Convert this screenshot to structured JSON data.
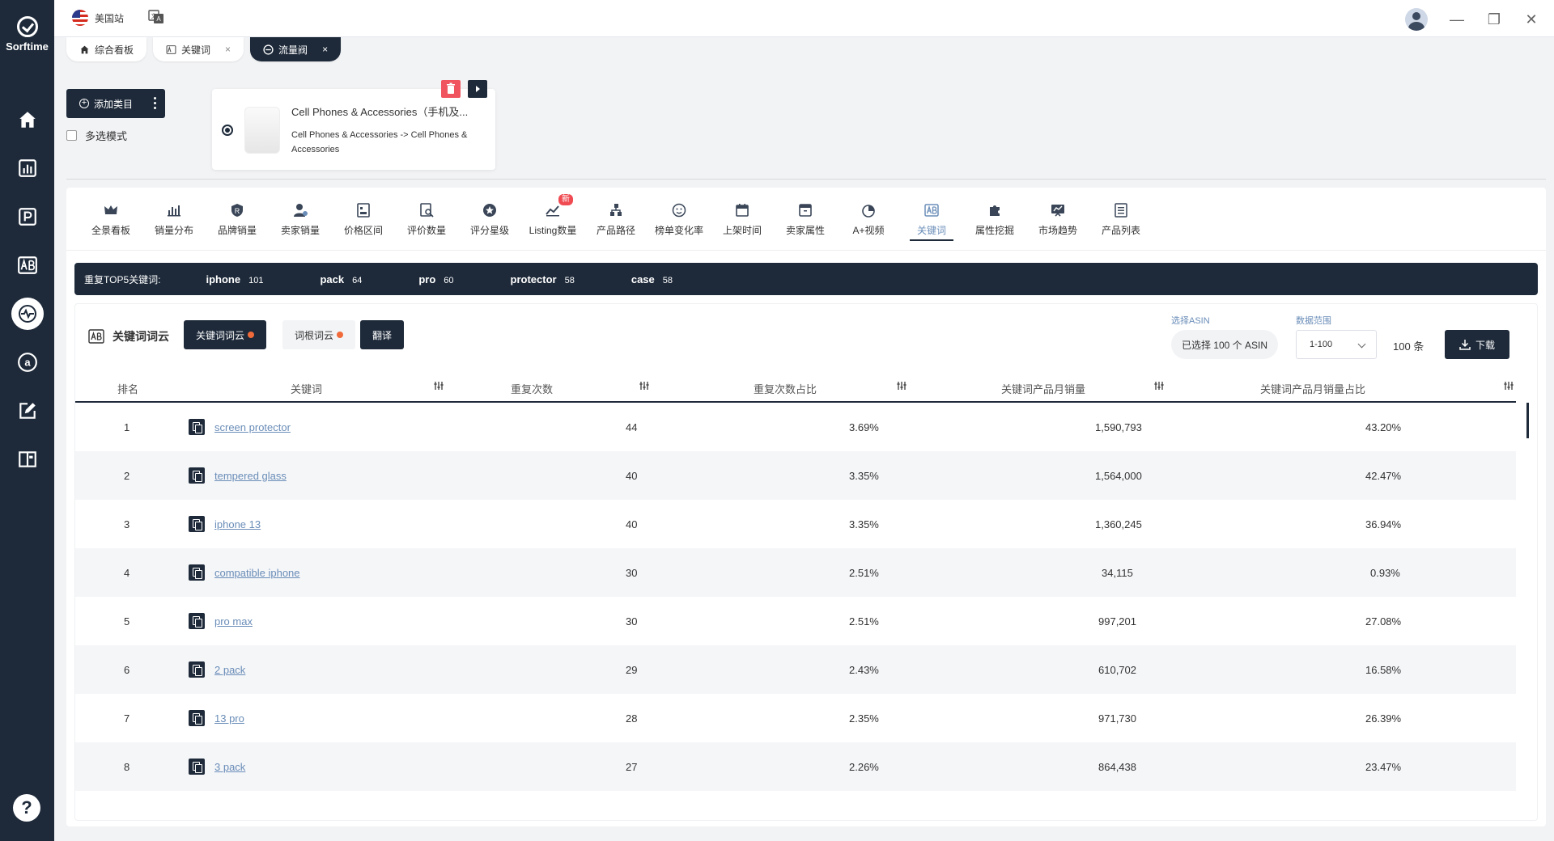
{
  "brand": {
    "name": "Sorftime"
  },
  "sidebar": {
    "items": [
      {
        "icon": "home-icon"
      },
      {
        "icon": "chart-icon"
      },
      {
        "icon": "product-icon"
      },
      {
        "icon": "keyword-icon"
      },
      {
        "icon": "traffic-icon"
      },
      {
        "icon": "amazon-icon"
      },
      {
        "icon": "edit-icon"
      },
      {
        "icon": "book-icon"
      }
    ],
    "help_label": "?"
  },
  "topbar": {
    "site": "美国站"
  },
  "tabs": [
    {
      "label": "综合看板",
      "closable": false,
      "active": false
    },
    {
      "label": "关键词",
      "closable": true,
      "active": false
    },
    {
      "label": "流量阀",
      "closable": true,
      "active": true
    }
  ],
  "category": {
    "add_label": "添加类目",
    "multi_label": "多选模式",
    "card_title": "Cell Phones & Accessories（手机及...",
    "card_path": "Cell Phones & Accessories -> Cell Phones & Accessories"
  },
  "functions": [
    {
      "label": "全景看板"
    },
    {
      "label": "销量分布"
    },
    {
      "label": "品牌销量"
    },
    {
      "label": "卖家销量"
    },
    {
      "label": "价格区间"
    },
    {
      "label": "评价数量"
    },
    {
      "label": "评分星级"
    },
    {
      "label": "Listing数量",
      "badge": "新"
    },
    {
      "label": "产品路径"
    },
    {
      "label": "榜单变化率"
    },
    {
      "label": "上架时间"
    },
    {
      "label": "卖家属性"
    },
    {
      "label": "A+视频"
    },
    {
      "label": "关键词",
      "active": true
    },
    {
      "label": "属性挖掘"
    },
    {
      "label": "市场趋势"
    },
    {
      "label": "产品列表"
    }
  ],
  "top5": {
    "label": "重复TOP5关键词:",
    "keywords": [
      {
        "word": "iphone",
        "count": "101"
      },
      {
        "word": "pack",
        "count": "64"
      },
      {
        "word": "pro",
        "count": "60"
      },
      {
        "word": "protector",
        "count": "58"
      },
      {
        "word": "case",
        "count": "58"
      }
    ]
  },
  "cloud": {
    "title": "关键词词云",
    "btn_keyword_cloud": "关键词词云",
    "btn_root_cloud": "词根词云",
    "btn_translate": "翻译",
    "asin_label": "选择ASIN",
    "asin_value": "已选择 100 个 ASIN",
    "range_label": "数据范围",
    "range_value": "1-100",
    "count": "100 条",
    "download": "下载"
  },
  "table": {
    "headers": [
      "排名",
      "关键词",
      "重复次数",
      "重复次数占比",
      "关键词产品月销量",
      "关键词产品月销量占比"
    ],
    "rows": [
      {
        "rank": "1",
        "keyword": "screen protector",
        "repeat": "44",
        "ratio": "3.69%",
        "sales": "1,590,793",
        "sales_ratio": "43.20%"
      },
      {
        "rank": "2",
        "keyword": "tempered glass",
        "repeat": "40",
        "ratio": "3.35%",
        "sales": "1,564,000",
        "sales_ratio": "42.47%"
      },
      {
        "rank": "3",
        "keyword": "iphone 13",
        "repeat": "40",
        "ratio": "3.35%",
        "sales": "1,360,245",
        "sales_ratio": "36.94%"
      },
      {
        "rank": "4",
        "keyword": "compatible iphone",
        "repeat": "30",
        "ratio": "2.51%",
        "sales": "34,115",
        "sales_ratio": "0.93%"
      },
      {
        "rank": "5",
        "keyword": "pro max",
        "repeat": "30",
        "ratio": "2.51%",
        "sales": "997,201",
        "sales_ratio": "27.08%"
      },
      {
        "rank": "6",
        "keyword": "2 pack",
        "repeat": "29",
        "ratio": "2.43%",
        "sales": "610,702",
        "sales_ratio": "16.58%"
      },
      {
        "rank": "7",
        "keyword": "13 pro",
        "repeat": "28",
        "ratio": "2.35%",
        "sales": "971,730",
        "sales_ratio": "26.39%"
      },
      {
        "rank": "8",
        "keyword": "3 pack",
        "repeat": "27",
        "ratio": "2.26%",
        "sales": "864,438",
        "sales_ratio": "23.47%"
      }
    ]
  }
}
